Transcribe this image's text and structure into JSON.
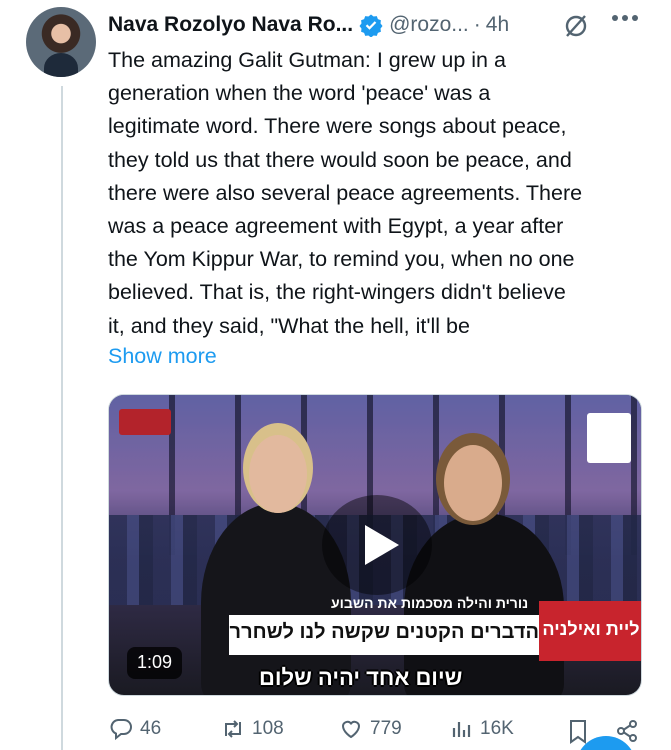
{
  "tweet": {
    "author_name": "Nava Rozolyo Nava Ro...",
    "handle": "@rozo...",
    "separator": "·",
    "time": "4h",
    "text_lines": [
      "The amazing Galit Gutman: I grew up in a",
      "generation when the word 'peace' was a",
      "legitimate word. There were songs about peace,",
      "they told us that there would soon be peace, and",
      "there were also several peace agreements. There",
      "was a peace agreement with Egypt, a year after",
      "the Yom Kippur War, to remind you, when no one",
      "believed. That is, the right-wingers didn't believe",
      "it, and they said, \"What the hell, it'll be"
    ],
    "show_more": "Show more"
  },
  "video": {
    "duration": "1:09",
    "caption_top": "נורית והילה מסכמות את השבוע",
    "caption_main": "הדברים הקטנים שקשה לנו לשחרר",
    "caption_brand": "ליית ואילניה",
    "subtitle": "שיום אחד יהיה שלום"
  },
  "actions": {
    "replies": "46",
    "reposts": "108",
    "likes": "779",
    "views": "16K"
  },
  "colors": {
    "accent": "#1d9bf0",
    "secondary_text": "#536471",
    "primary_text": "#0f1419"
  },
  "icons": [
    "verified-badge-icon",
    "grok-icon",
    "more-icon",
    "reply-icon",
    "repost-icon",
    "like-icon",
    "views-icon",
    "bookmark-icon",
    "share-icon",
    "play-icon"
  ]
}
